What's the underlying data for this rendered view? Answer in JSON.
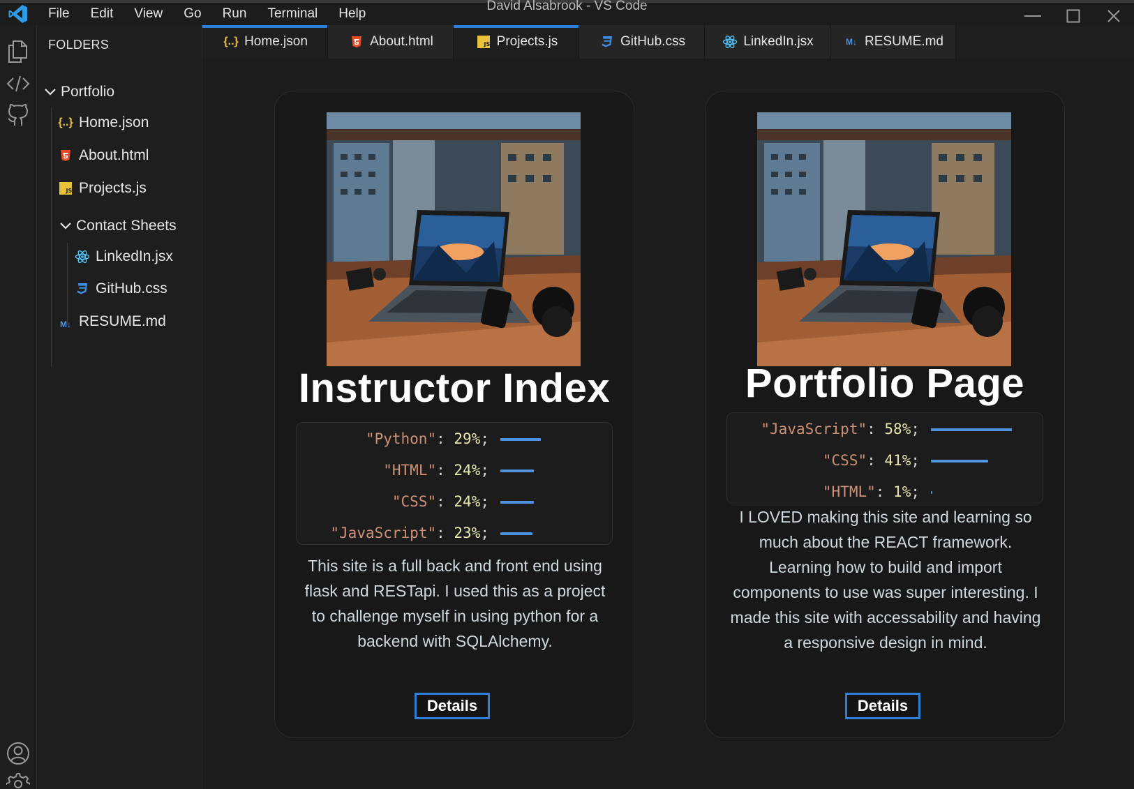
{
  "window": {
    "title": "David Alsabrook - VS Code",
    "menu": [
      "File",
      "Edit",
      "View",
      "Go",
      "Run",
      "Terminal",
      "Help"
    ]
  },
  "sidebar": {
    "title": "FOLDERS",
    "root": "Portfolio",
    "files": [
      {
        "label": "Home.json",
        "icon": "json-file-icon"
      },
      {
        "label": "About.html",
        "icon": "html5-file-icon"
      },
      {
        "label": "Projects.js",
        "icon": "js-file-icon"
      }
    ],
    "subfolder": "Contact Sheets",
    "subfiles": [
      {
        "label": "LinkedIn.jsx",
        "icon": "react-file-icon"
      },
      {
        "label": "GitHub.css",
        "icon": "css3-file-icon"
      }
    ],
    "last_file": {
      "label": "RESUME.md",
      "icon": "markdown-file-icon"
    }
  },
  "tabs": [
    {
      "label": "Home.json",
      "icon": "json-file-icon",
      "active": true
    },
    {
      "label": "About.html",
      "icon": "html5-file-icon",
      "active": false
    },
    {
      "label": "Projects.js",
      "icon": "js-file-icon",
      "active": true
    },
    {
      "label": "GitHub.css",
      "icon": "css3-file-icon",
      "active": false
    },
    {
      "label": "LinkedIn.jsx",
      "icon": "react-file-icon",
      "active": false
    },
    {
      "label": "RESUME.md",
      "icon": "markdown-file-icon",
      "active": false
    }
  ],
  "projects": [
    {
      "title": "Instructor Index",
      "stats": [
        {
          "lang": "\"Python\"",
          "pct": "29%",
          "value": 29
        },
        {
          "lang": "\"HTML\"",
          "pct": "24%",
          "value": 24
        },
        {
          "lang": "\"CSS\"",
          "pct": "24%",
          "value": 24
        },
        {
          "lang": "\"JavaScript\"",
          "pct": "23%",
          "value": 23
        }
      ],
      "description": "This site is a full back and front end using flask and RESTapi. I used this as a project to challenge myself in using python for a backend with SQLAlchemy.",
      "button": "Details"
    },
    {
      "title": "Portfolio Page",
      "stats": [
        {
          "lang": "\"JavaScript\"",
          "pct": "58%",
          "value": 58
        },
        {
          "lang": "\"CSS\"",
          "pct": "41%",
          "value": 41
        },
        {
          "lang": "\"HTML\"",
          "pct": "1%",
          "value": 1
        }
      ],
      "description": "I LOVED making this site and learning so much about the REACT framework. Learning how to build and import components to use was super interesting. I made this site with accessability and having a responsive design in mind.",
      "button": "Details"
    }
  ],
  "colors": {
    "accent": "#2f7fd6",
    "bar": "#4f93e0",
    "string": "#ce9178",
    "number": "#e8e6b0"
  }
}
